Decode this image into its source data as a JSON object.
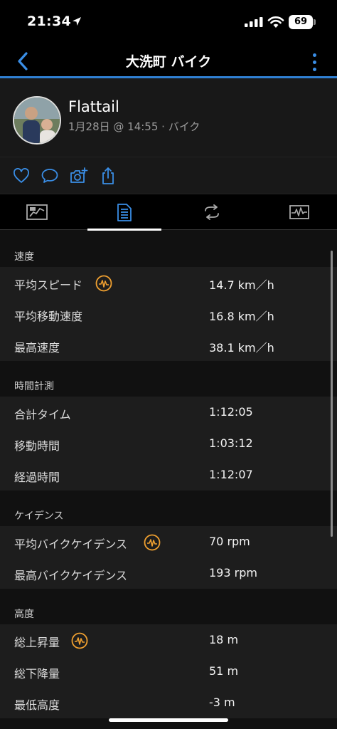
{
  "status": {
    "time": "21:34",
    "battery": "69"
  },
  "nav": {
    "title": "大洗町 バイク"
  },
  "profile": {
    "name": "Flattail",
    "meta": "1月28日 @ 14:55 · バイク"
  },
  "actions": [
    "heart-icon",
    "comment-icon",
    "add-photo-icon",
    "share-icon"
  ],
  "tabs": [
    {
      "name": "overview",
      "icon": "map-chart-icon"
    },
    {
      "name": "stats",
      "icon": "list-icon",
      "active": true
    },
    {
      "name": "laps",
      "icon": "laps-icon"
    },
    {
      "name": "charts",
      "icon": "waveform-icon"
    }
  ],
  "sections": {
    "speed": {
      "title": "速度",
      "rows": [
        {
          "label": "平均スピード",
          "value": "14.7 km／h",
          "badge": true
        },
        {
          "label": "平均移動速度",
          "value": "16.8 km／h"
        },
        {
          "label": "最高速度",
          "value": "38.1 km／h"
        }
      ]
    },
    "timing": {
      "title": "時間計測",
      "rows": [
        {
          "label": "合計タイム",
          "value": "1:12:05"
        },
        {
          "label": "移動時間",
          "value": "1:03:12"
        },
        {
          "label": "経過時間",
          "value": "1:12:07"
        }
      ]
    },
    "cadence": {
      "title": "ケイデンス",
      "rows": [
        {
          "label": "平均バイクケイデンス",
          "value": "70 rpm",
          "badge": true
        },
        {
          "label": "最高バイクケイデンス",
          "value": "193 rpm"
        }
      ]
    },
    "elevation": {
      "title": "高度",
      "rows": [
        {
          "label": "総上昇量",
          "value": "18 m",
          "badge": true
        },
        {
          "label": "総下降量",
          "value": "51 m"
        },
        {
          "label": "最低高度",
          "value": "-3 m"
        }
      ]
    }
  },
  "colors": {
    "accent": "#3a8ee6",
    "badge": "#f0a030",
    "navUnderline": "#2f7fd2"
  }
}
